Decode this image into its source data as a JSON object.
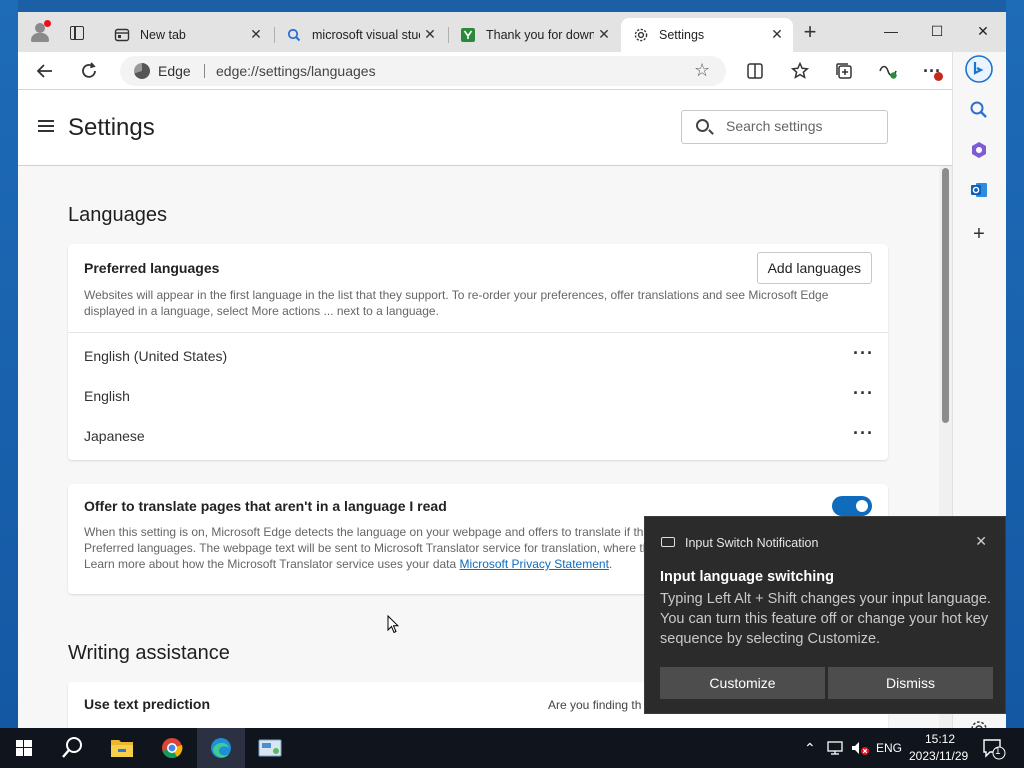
{
  "browser": {
    "tabs": [
      {
        "label": "New tab",
        "icon": "newtab-icon"
      },
      {
        "label": "microsoft visual stuc",
        "icon": "search-icon"
      },
      {
        "label": "Thank you for down",
        "icon": "download-site-icon"
      },
      {
        "label": "Settings",
        "icon": "gear-icon"
      }
    ],
    "address": {
      "site_label": "Edge",
      "url": "edge://settings/languages"
    }
  },
  "settings": {
    "title": "Settings",
    "search_placeholder": "Search settings",
    "languages": {
      "title": "Languages",
      "preferred": {
        "title": "Preferred languages",
        "description": "Websites will appear in the first language in the list that they support. To re-order your preferences, offer translations and see Microsoft Edge displayed in a language, select More actions ... next to a language.",
        "add_button": "Add languages",
        "items": [
          "English (United States)",
          "English",
          "Japanese"
        ]
      },
      "translate": {
        "title": "Offer to translate pages that aren't in a language I read",
        "description": "When this setting is on, Microsoft Edge detects the language on your webpage and offers to translate if th",
        "description2": "Preferred languages. The webpage text will be sent to Microsoft Translator service for translation, where th",
        "description3": "Learn more about how the Microsoft Translator service uses your data",
        "link": "Microsoft Privacy Statement",
        "enabled": true
      }
    },
    "writing_assistance": {
      "title": "Writing assistance",
      "item_title": "Use text prediction",
      "right_text": "Are you finding th"
    }
  },
  "notification": {
    "app": "Input Switch Notification",
    "title": "Input language switching",
    "body": "Typing Left Alt + Shift changes your input language. You can turn this feature off or change your hot key sequence by selecting Customize.",
    "customize": "Customize",
    "dismiss": "Dismiss"
  },
  "taskbar": {
    "language": "ENG",
    "time": "15:12",
    "date": "2023/11/29",
    "notification_count": "1"
  },
  "colors": {
    "accent": "#0f6cbd",
    "toast_bg": "#2b2b2b",
    "taskbar_bg": "#10141c"
  }
}
